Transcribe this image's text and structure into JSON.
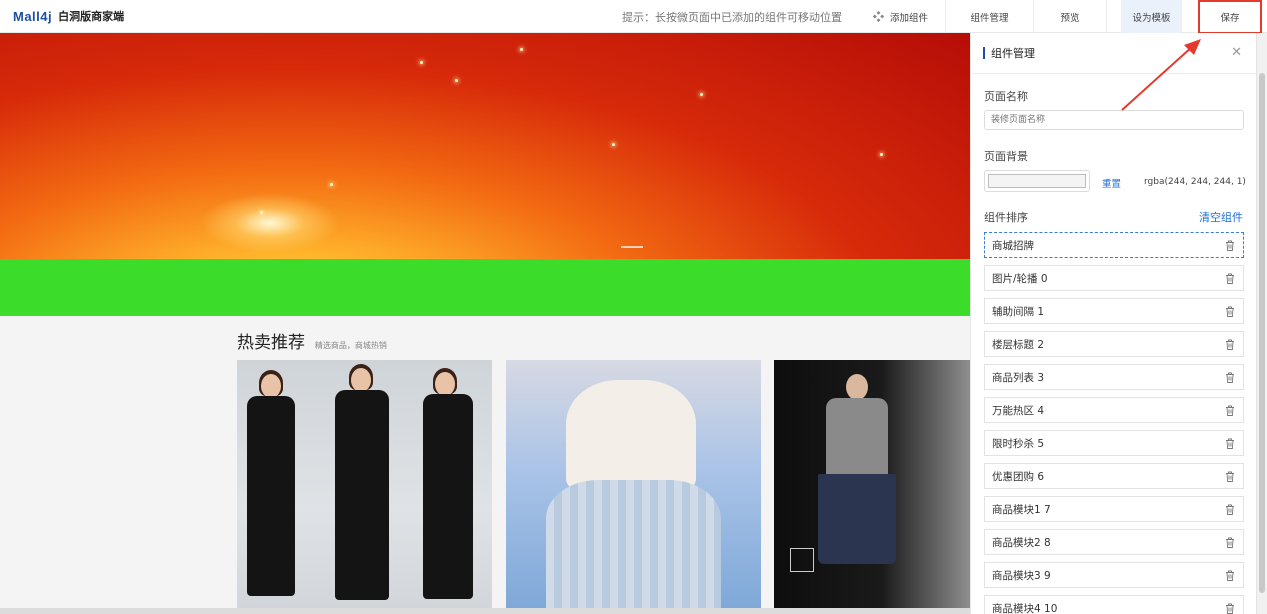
{
  "header": {
    "logo_mark": "Mall4j",
    "logo_text": "白洞版商家端",
    "tip": "提示：长按微页面中已添加的组件可移动位置",
    "add_component": "添加组件",
    "component_manage": "组件管理",
    "preview": "预览",
    "set_template": "设为模板",
    "save": "保存"
  },
  "canvas": {
    "floor_title": "热卖推荐",
    "floor_subtitle": "精选商品，商城热销",
    "banner_color": "#d72a0a",
    "spacer_color": "#3cdc2b"
  },
  "panel": {
    "title": "组件管理",
    "page_name_label": "页面名称",
    "page_name_placeholder": "装修页面名称",
    "page_bg_label": "页面背景",
    "reset": "重置",
    "bg_value": "rgba(244, 244, 244, 1)",
    "sort_label": "组件排序",
    "clear": "清空组件",
    "components": [
      {
        "label": "商城招牌"
      },
      {
        "label": "图片/轮播 0"
      },
      {
        "label": "辅助间隔 1"
      },
      {
        "label": "楼层标题 2"
      },
      {
        "label": "商品列表 3"
      },
      {
        "label": "万能热区 4"
      },
      {
        "label": "限时秒杀 5"
      },
      {
        "label": "优惠团购 6"
      },
      {
        "label": "商品模块1 7"
      },
      {
        "label": "商品模块2 8"
      },
      {
        "label": "商品模块3 9"
      },
      {
        "label": "商品模块4 10"
      }
    ]
  },
  "colors": {
    "accent": "#1e6fd9",
    "highlight": "#e33a2d"
  }
}
